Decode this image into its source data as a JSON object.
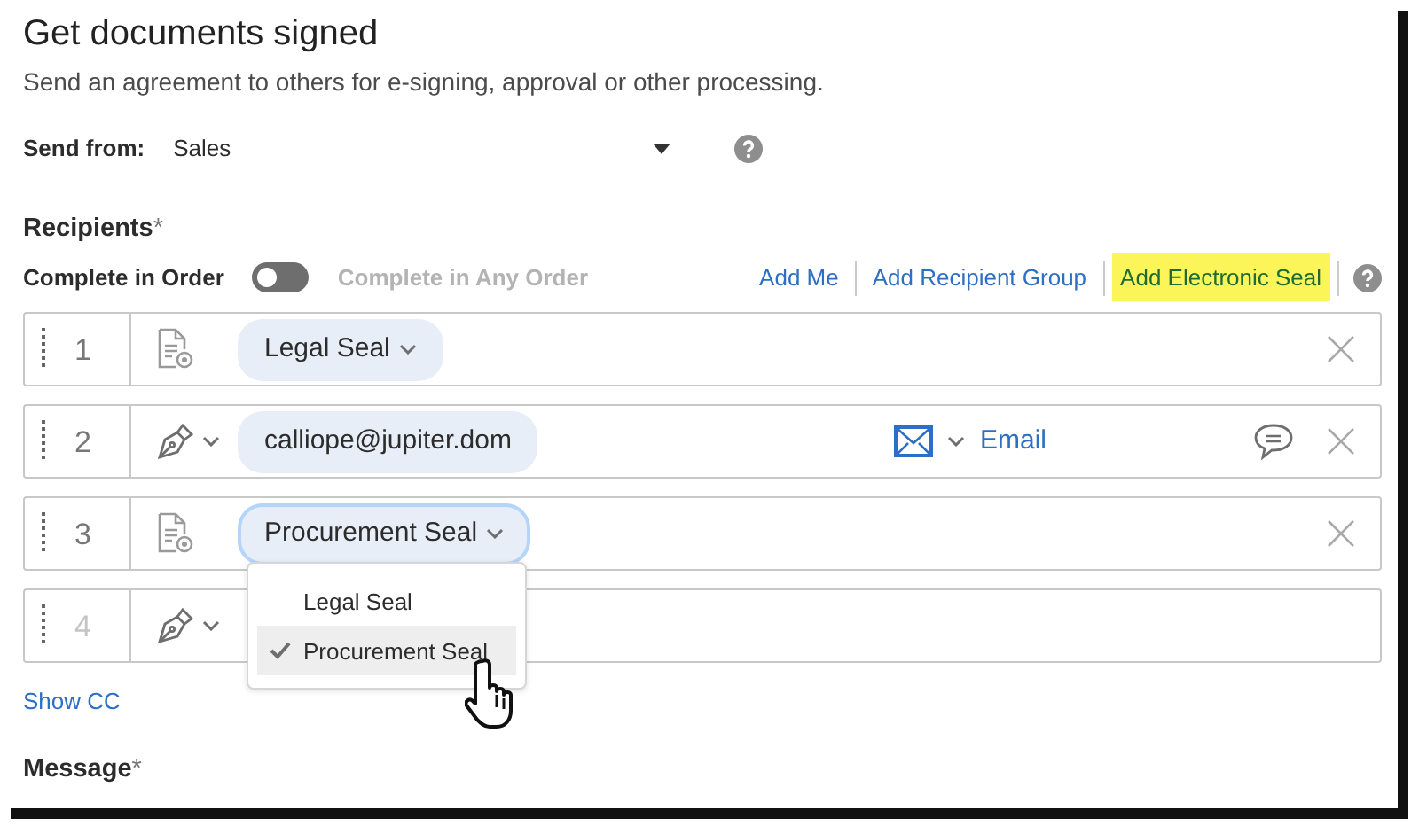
{
  "title": "Get documents signed",
  "subtitle": "Send an agreement to others for e-signing, approval or other processing.",
  "send_from": {
    "label": "Send from:",
    "value": "Sales"
  },
  "recipients": {
    "label": "Recipients",
    "required_mark": "*"
  },
  "order": {
    "left_label": "Complete in Order",
    "right_label": "Complete in Any Order",
    "on": false
  },
  "links": [
    {
      "label": "Add Me",
      "highlighted": false
    },
    {
      "label": "Add Recipient Group",
      "highlighted": false
    },
    {
      "label": "Add Electronic Seal",
      "highlighted": true
    }
  ],
  "rows": [
    {
      "number": "1",
      "kind": "seal",
      "value": "Legal Seal",
      "active": true,
      "focused": false
    },
    {
      "number": "2",
      "kind": "signer",
      "value": "calliope@jupiter.dom",
      "delivery": "Email",
      "active": true,
      "focused": false
    },
    {
      "number": "3",
      "kind": "seal",
      "value": "Procurement Seal",
      "active": true,
      "focused": true
    },
    {
      "number": "4",
      "kind": "signer",
      "active": false,
      "focused": false
    }
  ],
  "dropdown": [
    {
      "label": "Legal Seal",
      "selected": false
    },
    {
      "label": "Procurement Seal",
      "selected": true
    }
  ],
  "show_cc": "Show CC",
  "message": {
    "label": "Message",
    "required_mark": "*"
  }
}
